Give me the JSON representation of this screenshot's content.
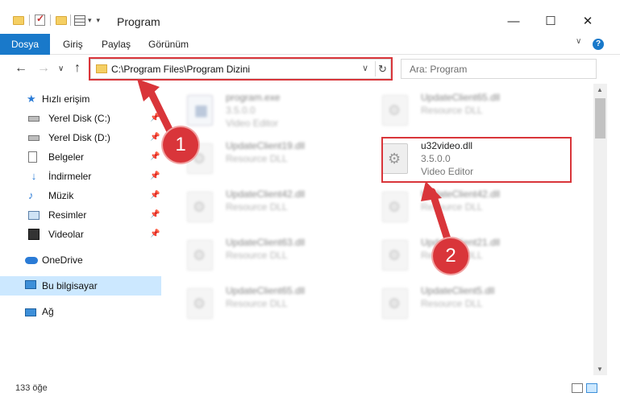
{
  "window": {
    "title": "Program",
    "minimize": "—",
    "maximize": "☐",
    "close": "✕"
  },
  "ribbon": {
    "tabs": [
      "Dosya",
      "Giriş",
      "Paylaş",
      "Görünüm"
    ],
    "help": "?",
    "toggle": "∨"
  },
  "nav": {
    "back": "←",
    "forward": "→",
    "history": "∨",
    "up": "↑",
    "address": "C:\\Program Files\\Program Dizini",
    "dropdown": "∨",
    "refresh": "↻",
    "search_placeholder": "Ara: Program"
  },
  "sidebar": {
    "items": [
      {
        "label": "Hızlı erişim"
      },
      {
        "label": "Yerel Disk (C:)",
        "pin": "📌"
      },
      {
        "label": "Yerel Disk (D:)",
        "pin": "📌"
      },
      {
        "label": "Belgeler",
        "pin": "📌"
      },
      {
        "label": "İndirmeler",
        "pin": "📌"
      },
      {
        "label": "Müzik",
        "pin": "📌"
      },
      {
        "label": "Resimler",
        "pin": "📌"
      },
      {
        "label": "Videolar",
        "pin": "📌"
      },
      {
        "label": "OneDrive"
      },
      {
        "label": "Bu bilgisayar"
      },
      {
        "label": "Ağ"
      }
    ]
  },
  "files": {
    "left": [
      {
        "name": "program.exe",
        "type": "3.5.0.0",
        "desc": "Video Editor"
      },
      {
        "name": "UpdateClient19.dll",
        "type": "Resource DLL"
      },
      {
        "name": "UpdateClient42.dll",
        "type": "Resource DLL"
      },
      {
        "name": "UpdateClient63.dll",
        "type": "Resource DLL"
      },
      {
        "name": "UpdateClient65.dll",
        "type": "Resource DLL"
      }
    ],
    "right": [
      {
        "name": "UpdateClient65.dll",
        "type": "Resource DLL"
      },
      {
        "name": "u32video.dll",
        "type": "3.5.0.0",
        "desc": "Video Editor"
      },
      {
        "name": "UpdateClient42.dll",
        "type": "Resource DLL"
      },
      {
        "name": "UpdateClient21.dll",
        "type": "Resource DLL"
      },
      {
        "name": "UpdateClient5.dll",
        "type": "Resource DLL"
      }
    ]
  },
  "callouts": {
    "one": "1",
    "two": "2"
  },
  "status": {
    "count": "133 öğe"
  },
  "colors": {
    "accent": "#1979ca",
    "highlight": "#d9353a",
    "selected": "#cce8ff"
  }
}
